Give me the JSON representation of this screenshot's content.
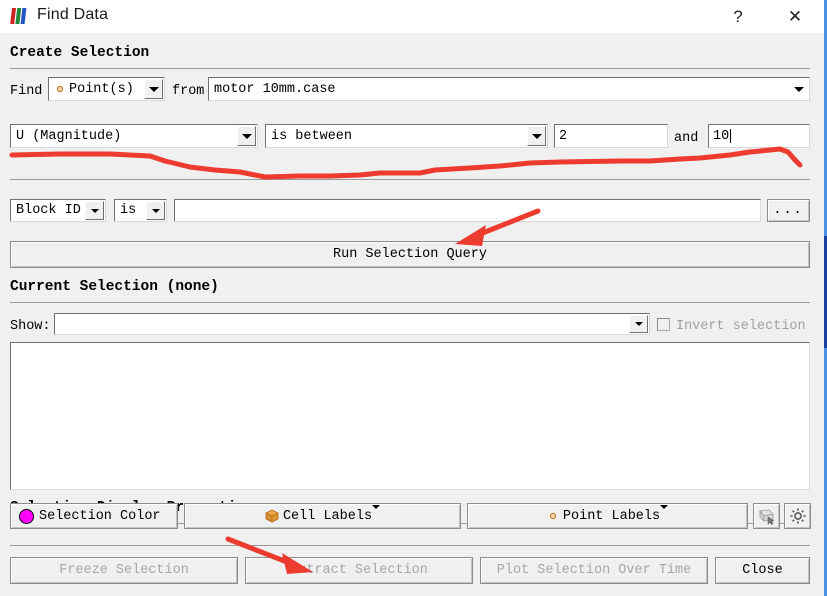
{
  "window": {
    "title": "Find Data",
    "icon": "paraview-logo-icon",
    "help_label": "?",
    "close_label": "✕",
    "focus_border_color": "#4a90e2"
  },
  "create_selection": {
    "group_title": "Create Selection",
    "find_label": "Find",
    "element_type": {
      "value": "Point(s)",
      "icon": "point-marker-icon"
    },
    "from_label": "from",
    "source": {
      "value": "motor 10mm.case"
    },
    "criteria_row": {
      "array": {
        "value": "U (Magnitude)"
      },
      "operator": {
        "value": "is between"
      },
      "min_value": "2",
      "and_label": "and",
      "max_value": "10",
      "max_has_caret": true
    },
    "extra_row": {
      "field": {
        "value": "Block ID"
      },
      "operator": {
        "value": "is"
      },
      "value": "",
      "browse_label": "..."
    },
    "run_query_label": "Run Selection Query"
  },
  "current_selection": {
    "group_title": "Current Selection (none)",
    "show_label": "Show:",
    "show_value": "",
    "invert_label": "Invert selection",
    "invert_checked": false,
    "invert_disabled": true,
    "list_items": []
  },
  "display_properties": {
    "group_title": "Selection Display Properties",
    "selection_color": {
      "label": "Selection Color",
      "color": "#ff00ff",
      "icon": "color-swatch-icon"
    },
    "cell_labels": {
      "label": "Cell Labels",
      "icon": "cell-cube-icon"
    },
    "point_labels": {
      "label": "Point Labels",
      "icon": "point-marker-icon"
    },
    "edit_button_icon": "pick-edit-icon",
    "settings_button_icon": "gear-icon"
  },
  "footer": {
    "buttons": [
      {
        "label": "Freeze Selection",
        "disabled": true
      },
      {
        "label": "Extract Selection",
        "disabled": true
      },
      {
        "label": "Plot Selection Over Time",
        "disabled": true
      },
      {
        "label": "Close",
        "disabled": false
      }
    ]
  },
  "annotations": {
    "color": "#ee3b2f",
    "underline_note": "hand-drawn red underline under criteria row",
    "arrow_1_target": "Run Selection Query",
    "arrow_2_target": "Extract Selection"
  }
}
